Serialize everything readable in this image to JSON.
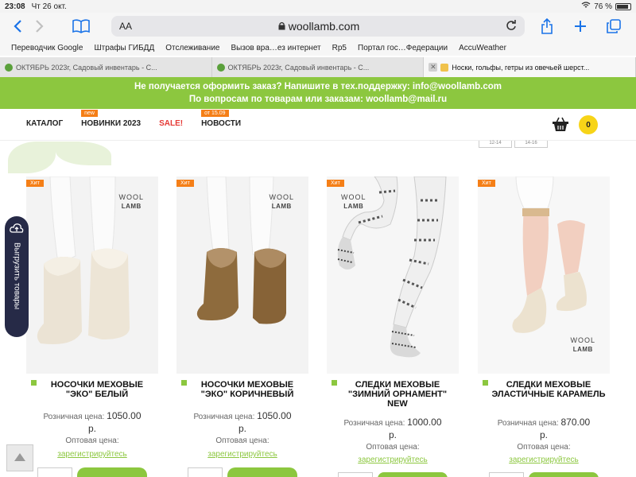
{
  "status": {
    "time": "23:08",
    "date": "Чт 26 окт.",
    "battery": "76 %",
    "battery_level": 0.76
  },
  "browser": {
    "aa": "AA",
    "url": "woollamb.com"
  },
  "bookmarks": [
    "Переводчик Google",
    "Штрафы ГИБДД",
    "Отслеживание",
    "Вызов вра…ез интернет",
    "Rp5",
    "Портал гос…Федерации",
    "AccuWeather"
  ],
  "tabs": [
    {
      "label": "ОКТЯБРЬ 2023г, Садовый инвентарь - С...",
      "active": false
    },
    {
      "label": "ОКТЯБРЬ 2023г, Садовый инвентарь - С...",
      "active": false
    },
    {
      "label": "Носки, гольфы, гетры из овечьей шерст...",
      "active": true
    }
  ],
  "notice": {
    "line1": "Не получается оформить заказ? Напишите в тех.поддержку: info@woollamb.com",
    "line2": "По вопросам по товарам или заказам: woollamb@mail.ru"
  },
  "menu": {
    "catalog": "КАТАЛОГ",
    "new": "НОВИНКИ 2023",
    "new_tag": "new",
    "sale": "SALE!",
    "news": "НОВОСТИ",
    "news_tag": "от 15.09"
  },
  "cart_count": "0",
  "filter_fragment": [
    "12-14",
    "14-16"
  ],
  "upload_label": "Выгрузить товары",
  "products": [
    {
      "hit": "Хит",
      "brand1": "WOOL",
      "brand2": "LAMB",
      "title": "НОСОЧКИ МЕХОВЫЕ \"ЭКО\" БЕЛЫЙ",
      "price_label": "Розничная цена:",
      "price": "1050.00",
      "currency": "р.",
      "opt_label": "Оптовая цена:",
      "register": "зарегистрируйтесь"
    },
    {
      "hit": "Хит",
      "brand1": "WOOL",
      "brand2": "LAMB",
      "title": "НОСОЧКИ МЕХОВЫЕ \"ЭКО\" КОРИЧНЕВЫЙ",
      "price_label": "Розничная цена:",
      "price": "1050.00",
      "currency": "р.",
      "opt_label": "Оптовая цена:",
      "register": "зарегистрируйтесь"
    },
    {
      "hit": "Хит",
      "brand1": "WOOL",
      "brand2": "LAMB",
      "title": "СЛЕДКИ МЕХОВЫЕ \"ЗИМНИЙ ОРНАМЕНТ\" NEW",
      "price_label": "Розничная цена:",
      "price": "1000.00",
      "currency": "р.",
      "opt_label": "Оптовая цена:",
      "register": "зарегистрируйтесь"
    },
    {
      "hit": "Хит",
      "brand1": "WOOL",
      "brand2": "LAMB",
      "title": "СЛЕДКИ МЕХОВЫЕ ЭЛАСТИЧНЫЕ КАРАМЕЛЬ",
      "price_label": "Розничная цена:",
      "price": "870.00",
      "currency": "р.",
      "opt_label": "Оптовая цена:",
      "register": "зарегистрируйтесь"
    }
  ],
  "colors": {
    "accent_green": "#8cc73f",
    "orange_tag": "#f57f17",
    "sale_red": "#e53935",
    "cart_yellow": "#f7d418"
  }
}
